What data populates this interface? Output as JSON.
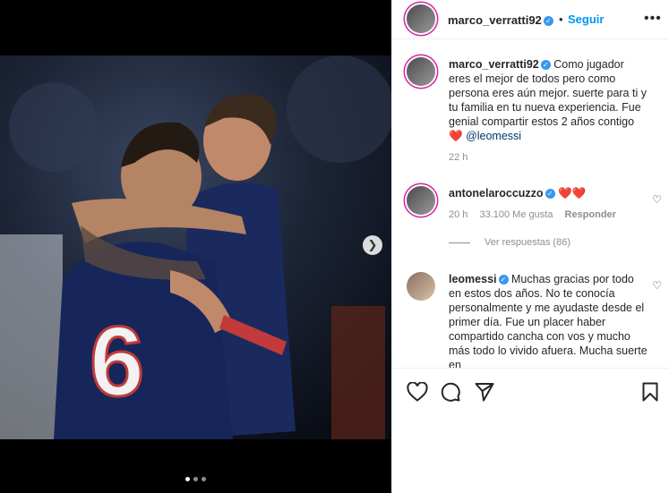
{
  "post": {
    "carousel_position": 1,
    "carousel_count": 3
  },
  "header": {
    "username": "marco_verratti92",
    "separator": "•",
    "follow_label": "Seguir",
    "more_icon": "more-horizontal-icon"
  },
  "caption": {
    "username": "marco_verratti92",
    "text": "Como jugador eres el mejor de todos pero como persona eres aún mejor. suerte para ti y tu familia en tu nueva experiencia. Fue genial compartir estos 2 años contigo",
    "emoji": "❤️",
    "mention": "@leomessi",
    "time": "22 h"
  },
  "comments": [
    {
      "username": "antonelaroccuzzo",
      "text": "❤️❤️",
      "time": "20 h",
      "likes": "33.100 Me gusta",
      "reply_label": "Responder",
      "view_replies": "Ver respuestas (86)"
    },
    {
      "username": "leomessi",
      "text": "Muchas gracias por todo en estos dos años. No te conocía personalmente y me ayudaste desde el primer día. Fue un placer haber compartido cancha con vos y mucho más todo lo vivido afuera. Mucha suerte en"
    }
  ],
  "actions": {
    "like_icon": "heart-outline-icon",
    "comment_icon": "comment-icon",
    "share_icon": "send-icon",
    "save_icon": "bookmark-icon"
  },
  "colors": {
    "accent": "#0095f6",
    "verified": "#3897f0",
    "heart": "#ed4956"
  }
}
